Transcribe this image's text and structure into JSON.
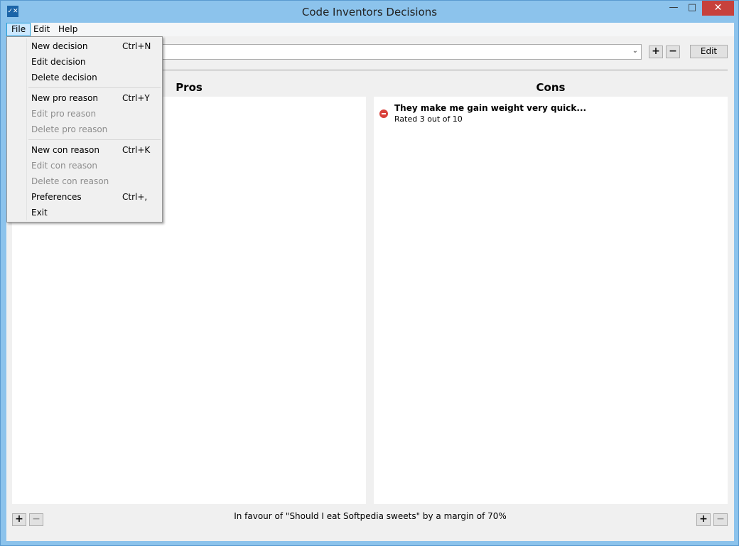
{
  "window": {
    "title": "Code Inventors Decisions",
    "app_icon": "✓✕",
    "minimize": "—",
    "maximize": "□",
    "close": "✕"
  },
  "menubar": {
    "file": "File",
    "edit": "Edit",
    "help": "Help"
  },
  "toolbar": {
    "add_decision": "+",
    "remove_decision": "−",
    "edit_label": "Edit",
    "dropdown_arrow": "⌄"
  },
  "pros": {
    "header": "Pros",
    "add": "+",
    "remove": "−"
  },
  "cons": {
    "header": "Cons",
    "add": "+",
    "remove": "−",
    "items": [
      {
        "title": "They make me gain weight very quick...",
        "rating": "Rated 3 out of 10"
      }
    ]
  },
  "status": "In favour of \"Should I eat Softpedia sweets\" by a margin of 70%",
  "file_menu": {
    "items": [
      {
        "label": "New decision",
        "shortcut": "Ctrl+N",
        "enabled": true
      },
      {
        "label": "Edit decision",
        "shortcut": "",
        "enabled": true
      },
      {
        "label": "Delete decision",
        "shortcut": "",
        "enabled": true
      },
      {
        "label": "New pro reason",
        "shortcut": "Ctrl+Y",
        "enabled": true
      },
      {
        "label": "Edit pro reason",
        "shortcut": "",
        "enabled": false
      },
      {
        "label": "Delete pro reason",
        "shortcut": "",
        "enabled": false
      },
      {
        "label": "New con reason",
        "shortcut": "Ctrl+K",
        "enabled": true
      },
      {
        "label": "Edit con reason",
        "shortcut": "",
        "enabled": false
      },
      {
        "label": "Delete con reason",
        "shortcut": "",
        "enabled": false
      },
      {
        "label": "Preferences",
        "shortcut": "Ctrl+,",
        "enabled": true
      },
      {
        "label": "Exit",
        "shortcut": "",
        "enabled": true
      }
    ]
  }
}
